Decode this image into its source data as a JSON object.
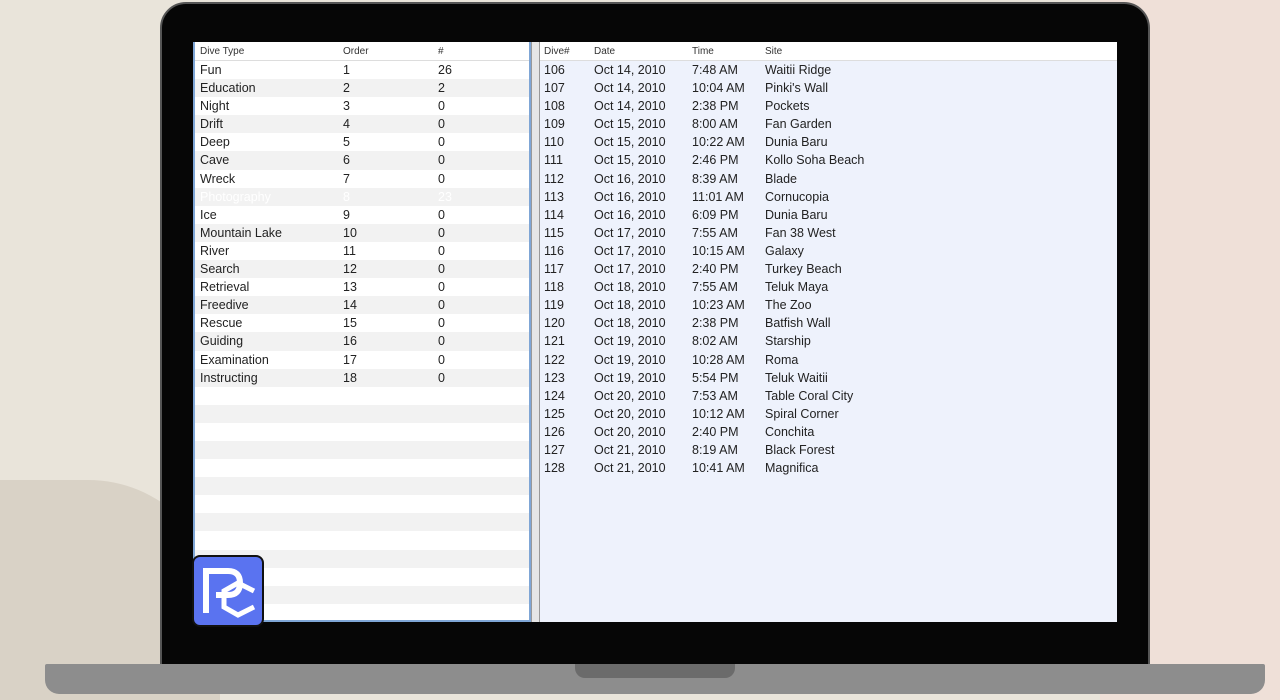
{
  "dive_types": {
    "headers": [
      "Dive Type",
      "Order",
      "#"
    ],
    "selected_index": 7,
    "rows": [
      [
        "Fun",
        "1",
        "26"
      ],
      [
        "Education",
        "2",
        "2"
      ],
      [
        "Night",
        "3",
        "0"
      ],
      [
        "Drift",
        "4",
        "0"
      ],
      [
        "Deep",
        "5",
        "0"
      ],
      [
        "Cave",
        "6",
        "0"
      ],
      [
        "Wreck",
        "7",
        "0"
      ],
      [
        "Photography",
        "8",
        "23"
      ],
      [
        "Ice",
        "9",
        "0"
      ],
      [
        "Mountain Lake",
        "10",
        "0"
      ],
      [
        "River",
        "11",
        "0"
      ],
      [
        "Search",
        "12",
        "0"
      ],
      [
        "Retrieval",
        "13",
        "0"
      ],
      [
        "Freedive",
        "14",
        "0"
      ],
      [
        "Rescue",
        "15",
        "0"
      ],
      [
        "Guiding",
        "16",
        "0"
      ],
      [
        "Examination",
        "17",
        "0"
      ],
      [
        "Instructing",
        "18",
        "0"
      ]
    ]
  },
  "dives": {
    "headers": [
      "Dive#",
      "Date",
      "Time",
      "Site"
    ],
    "rows": [
      [
        "106",
        "Oct 14, 2010",
        "7:48 AM",
        "Waitii Ridge"
      ],
      [
        "107",
        "Oct 14, 2010",
        "10:04 AM",
        "Pinki's Wall"
      ],
      [
        "108",
        "Oct 14, 2010",
        "2:38 PM",
        "Pockets"
      ],
      [
        "109",
        "Oct 15, 2010",
        "8:00 AM",
        "Fan Garden"
      ],
      [
        "110",
        "Oct 15, 2010",
        "10:22 AM",
        "Dunia Baru"
      ],
      [
        "111",
        "Oct 15, 2010",
        "2:46 PM",
        "Kollo Soha Beach"
      ],
      [
        "112",
        "Oct 16, 2010",
        "8:39 AM",
        "Blade"
      ],
      [
        "113",
        "Oct 16, 2010",
        "11:01 AM",
        "Cornucopia"
      ],
      [
        "114",
        "Oct 16, 2010",
        "6:09 PM",
        "Dunia Baru"
      ],
      [
        "115",
        "Oct 17, 2010",
        "7:55 AM",
        "Fan 38 West"
      ],
      [
        "116",
        "Oct 17, 2010",
        "10:15 AM",
        "Galaxy"
      ],
      [
        "117",
        "Oct 17, 2010",
        "2:40 PM",
        "Turkey Beach"
      ],
      [
        "118",
        "Oct 18, 2010",
        "7:55 AM",
        "Teluk Maya"
      ],
      [
        "119",
        "Oct 18, 2010",
        "10:23 AM",
        "The Zoo"
      ],
      [
        "120",
        "Oct 18, 2010",
        "2:38 PM",
        "Batfish Wall"
      ],
      [
        "121",
        "Oct 19, 2010",
        "8:02 AM",
        "Starship"
      ],
      [
        "122",
        "Oct 19, 2010",
        "10:28 AM",
        "Roma"
      ],
      [
        "123",
        "Oct 19, 2010",
        "5:54 PM",
        "Teluk Waitii"
      ],
      [
        "124",
        "Oct 20, 2010",
        "7:53 AM",
        "Table Coral City"
      ],
      [
        "125",
        "Oct 20, 2010",
        "10:12 AM",
        "Spiral Corner"
      ],
      [
        "126",
        "Oct 20, 2010",
        "2:40 PM",
        "Conchita"
      ],
      [
        "127",
        "Oct 21, 2010",
        "8:19 AM",
        "Black Forest"
      ],
      [
        "128",
        "Oct 21, 2010",
        "10:41 AM",
        "Magnifica"
      ]
    ]
  },
  "colors": {
    "selection": "#1a64d6",
    "logo": "#5a73f0"
  }
}
